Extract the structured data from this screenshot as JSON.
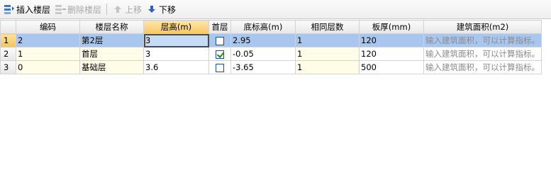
{
  "toolbar": {
    "insert_label": "插入楼层",
    "delete_label": "删除楼层",
    "up_label": "上移",
    "down_label": "下移"
  },
  "columns": [
    "编码",
    "楼层名称",
    "层高(m)",
    "首层",
    "底标高(m)",
    "相同层数",
    "板厚(mm)",
    "建筑面积(m2)"
  ],
  "rows": [
    {
      "num": "1",
      "code": "2",
      "name": "第2层",
      "height": "3",
      "first": false,
      "base": "2.95",
      "same": "1",
      "slab": "120",
      "area": "输入建筑面积，可以计算指标。"
    },
    {
      "num": "2",
      "code": "1",
      "name": "首层",
      "height": "3",
      "first": true,
      "base": "-0.05",
      "same": "1",
      "slab": "120",
      "area": "输入建筑面积，可以计算指标。"
    },
    {
      "num": "3",
      "code": "0",
      "name": "基础层",
      "height": "3.6",
      "first": false,
      "base": "-3.65",
      "same": "1",
      "slab": "500",
      "area": "输入建筑面积，可以计算指标。"
    }
  ],
  "colors": {
    "selected_row": "#a9c7ee",
    "editable_cell": "#fffde8",
    "active_header": "#f7c760"
  }
}
